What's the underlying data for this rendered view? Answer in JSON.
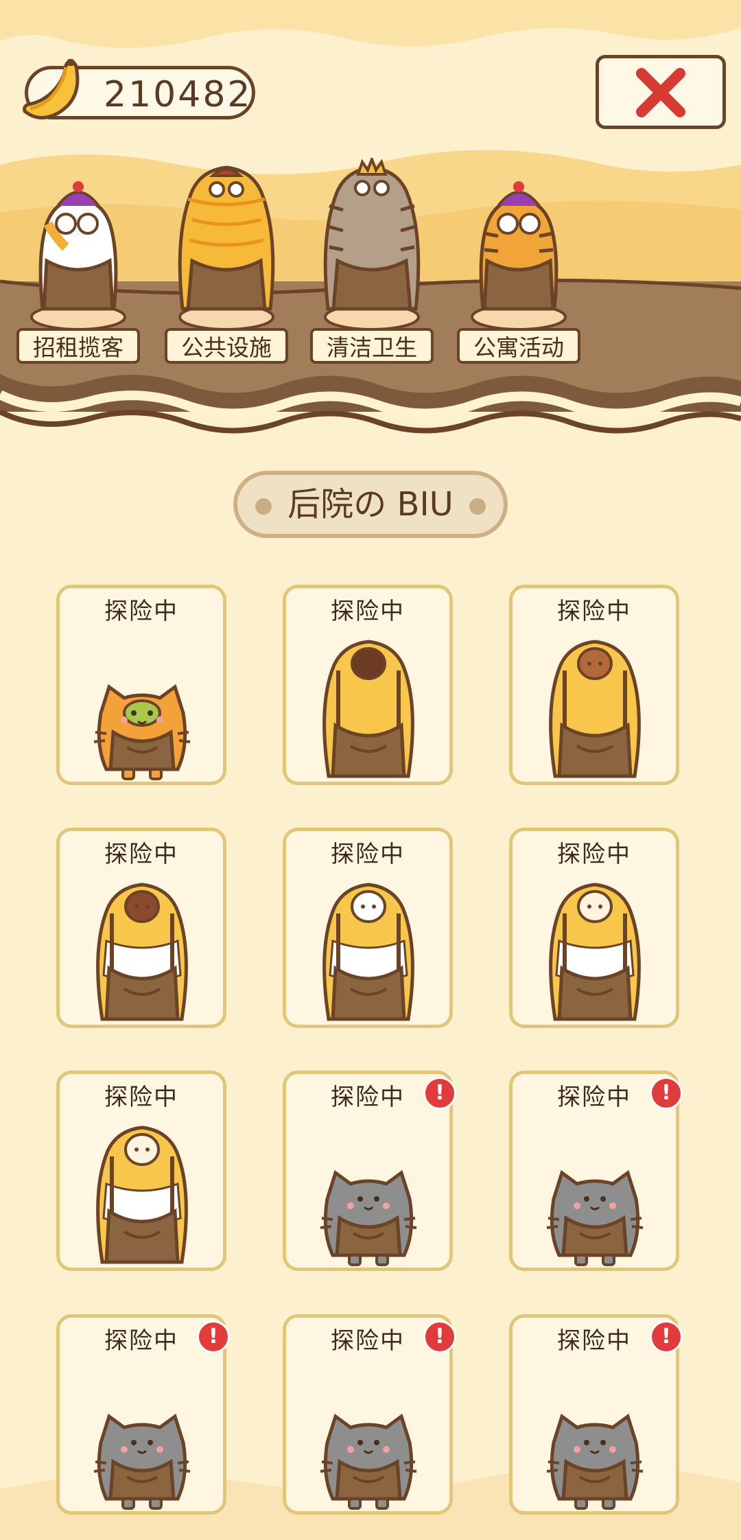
{
  "currency": {
    "value": "210482",
    "icon": "banana-icon"
  },
  "close": {
    "icon": "close-icon",
    "color": "#d63a32"
  },
  "staff": [
    {
      "name": "招租揽客",
      "fur": "#ffffff",
      "accent": "#f2b03b",
      "hat": "jester"
    },
    {
      "name": "公共设施",
      "fur": "#f7b93a",
      "accent": "#e89a1c",
      "hat": "cap"
    },
    {
      "name": "清洁卫生",
      "fur": "#b4a08a",
      "accent": "#8b7660",
      "hat": "crown"
    },
    {
      "name": "公寓活动",
      "fur": "#f1a437",
      "accent": "#d9782a",
      "hat": "jester"
    }
  ],
  "section": {
    "title": "后院の BIU"
  },
  "status_label": "探险中",
  "alert_glyph": "!",
  "pets": [
    {
      "status": "探险中",
      "alert": false,
      "body": "#f3a23a",
      "mask": "#a7c84a",
      "size": "small"
    },
    {
      "status": "探险中",
      "alert": false,
      "body": "#f7c64b",
      "mask": "#6d3b24",
      "size": "big"
    },
    {
      "status": "探险中",
      "alert": false,
      "body": "#f7c64b",
      "mask": "#b5683b",
      "size": "big"
    },
    {
      "status": "探险中",
      "alert": false,
      "body": "#f7c64b",
      "mask": "#8a4b2e",
      "size": "big",
      "stripe": "#ffffff"
    },
    {
      "status": "探险中",
      "alert": false,
      "body": "#f7c64b",
      "mask": "#ffffff",
      "size": "big",
      "stripe": "#ffffff"
    },
    {
      "status": "探险中",
      "alert": false,
      "body": "#f7c64b",
      "mask": "#fff4e0",
      "size": "big",
      "stripe": "#ffffff"
    },
    {
      "status": "探险中",
      "alert": false,
      "body": "#f7c64b",
      "mask": "#fff4e0",
      "size": "big",
      "stripe": "#ffffff"
    },
    {
      "status": "探险中",
      "alert": true,
      "body": "#8e8e8e",
      "mask": "#8e8e8e",
      "size": "small"
    },
    {
      "status": "探险中",
      "alert": true,
      "body": "#8e8e8e",
      "mask": "#8e8e8e",
      "size": "small"
    },
    {
      "status": "探险中",
      "alert": true,
      "body": "#8e8e8e",
      "mask": "#8e8e8e",
      "size": "small"
    },
    {
      "status": "探险中",
      "alert": true,
      "body": "#8e8e8e",
      "mask": "#8e8e8e",
      "size": "small"
    },
    {
      "status": "探险中",
      "alert": true,
      "body": "#8e8e8e",
      "mask": "#8e8e8e",
      "size": "small"
    }
  ]
}
